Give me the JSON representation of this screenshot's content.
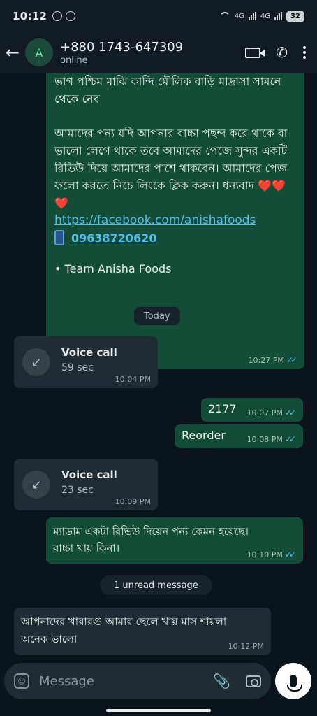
{
  "status_bar": {
    "time": "10:12",
    "network_1": "4G",
    "network_2": "4G",
    "battery": "32"
  },
  "header": {
    "avatar_letter": "A",
    "contact_name": "+880 1743-647309",
    "contact_status": "online"
  },
  "messages": {
    "big": {
      "para1": "ভাগ পশ্চিম মাঝি কান্দি মৌলিক বাড়ি মাদ্রাসা সামনে থেকে নেব",
      "para2": "আমাদের পন্য যদি আপনার বাচ্চা পছন্দ করে থাকে বা ভালো লেগে থাকে তবে আমাদের পেজে সুন্দর একটি রিভিউ দিয়ে আমাদের পাশে থাকবেন। আমাদের পেজ ফলো করতে নিচে লিংকে ক্লিক করুন। ধন্যবাদ",
      "hearts": "❤️❤️❤️",
      "link": "https://facebook.com/anishafoods",
      "phone": "09638720620",
      "signature": "•  Team Anisha Foods",
      "time": "10:27 PM"
    },
    "date_chip": "Today",
    "call1": {
      "title": "Voice call",
      "duration": "59 sec",
      "time": "10:04 PM"
    },
    "msg_2177": {
      "text": "2177",
      "time": "10:07 PM"
    },
    "msg_reorder": {
      "text": "Reorder",
      "time": "10:08 PM"
    },
    "call2": {
      "title": "Voice call",
      "duration": "23 sec",
      "time": "10:09 PM"
    },
    "msg_review": {
      "text": "ম্যাডাম একটা রিভিউ দিয়েন পন্য কেমন হয়েছে। বাচ্চা খায় কিনা।",
      "time": "10:10 PM"
    },
    "unread_chip": "1 unread message",
    "msg_incoming": {
      "text": "আপনাদের খাবারগু আমার ছেলে খায় মাস শায়লা অনেক ভালো",
      "time": "10:12 PM"
    }
  },
  "composer": {
    "placeholder": "Message"
  }
}
